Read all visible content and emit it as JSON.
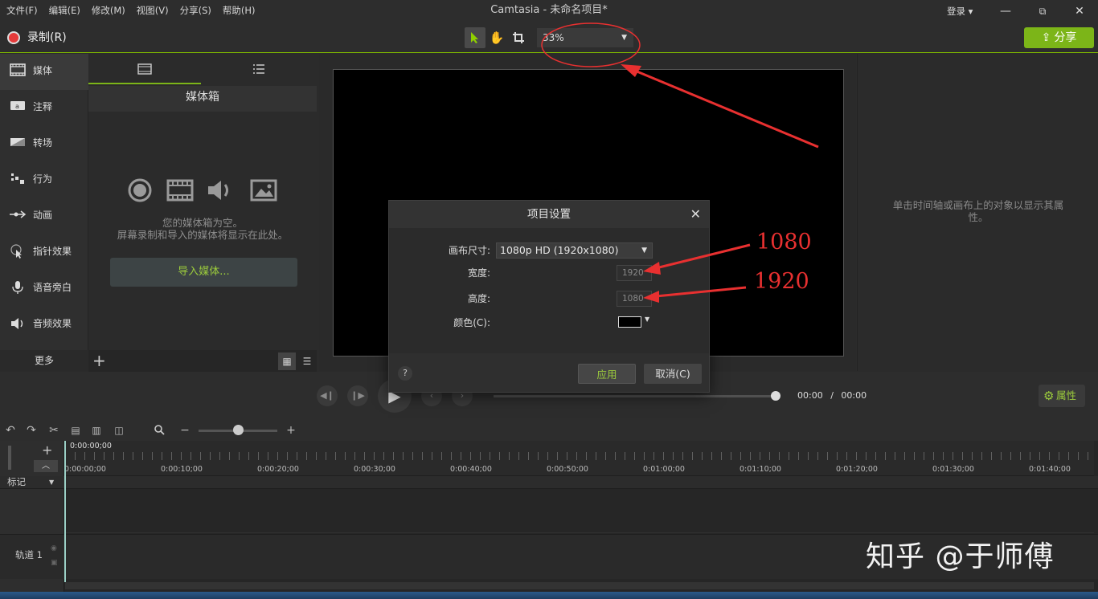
{
  "menu": [
    "文件(F)",
    "编辑(E)",
    "修改(M)",
    "视图(V)",
    "分享(S)",
    "帮助(H)"
  ],
  "window": {
    "title": "Camtasia - 未命名项目*",
    "login": "登录 ▾",
    "minimize": "—",
    "restore": "⧉",
    "close": "✕"
  },
  "toolbar": {
    "record_label": "录制(R)",
    "zoom_value": "33%",
    "share_label": "分享"
  },
  "sidebar": {
    "items": [
      {
        "label": "媒体",
        "icon": "film-icon"
      },
      {
        "label": "注释",
        "icon": "annotation-icon"
      },
      {
        "label": "转场",
        "icon": "transition-icon"
      },
      {
        "label": "行为",
        "icon": "behavior-icon"
      },
      {
        "label": "动画",
        "icon": "animation-icon"
      },
      {
        "label": "指针效果",
        "icon": "cursor-icon"
      },
      {
        "label": "语音旁白",
        "icon": "microphone-icon"
      },
      {
        "label": "音频效果",
        "icon": "speaker-icon"
      }
    ],
    "more_label": "更多"
  },
  "media": {
    "title": "媒体箱",
    "empty_line1": "您的媒体箱为空。",
    "empty_line2": "屏幕录制和导入的媒体将显示在此处。",
    "import_label": "导入媒体..."
  },
  "properties": {
    "hint": "单击时间轴或画布上的对象以显示其属性。",
    "button_label": "属性"
  },
  "playback": {
    "time_current": "00:00",
    "time_sep": "/",
    "time_total": "00:00"
  },
  "timeline": {
    "playhead_time": "0:00:00;00",
    "ticks": [
      "0:00:00;00",
      "0:00:10;00",
      "0:00:20;00",
      "0:00:30;00",
      "0:00:40;00",
      "0:00:50;00",
      "0:01:00;00",
      "0:01:10;00",
      "0:01:20;00",
      "0:01:30;00",
      "0:01:40;00"
    ],
    "marker_label": "标记",
    "track1_label": "轨道 1"
  },
  "dialog": {
    "title": "项目设置",
    "canvas_size_label": "画布尺寸:",
    "canvas_size_value": "1080p HD (1920x1080)",
    "width_label": "宽度:",
    "width_value": "1920",
    "height_label": "高度:",
    "height_value": "1080",
    "color_label": "颜色(C):",
    "help_label": "?",
    "apply_label": "应用",
    "cancel_label": "取消(C)"
  },
  "annotations": {
    "label_1080": "1080",
    "label_1920": "1920",
    "annotation_color": "#e83030"
  },
  "watermark": "知乎 @于师傅",
  "colors": {
    "accent": "#7cb518",
    "record": "#e53a3a"
  }
}
